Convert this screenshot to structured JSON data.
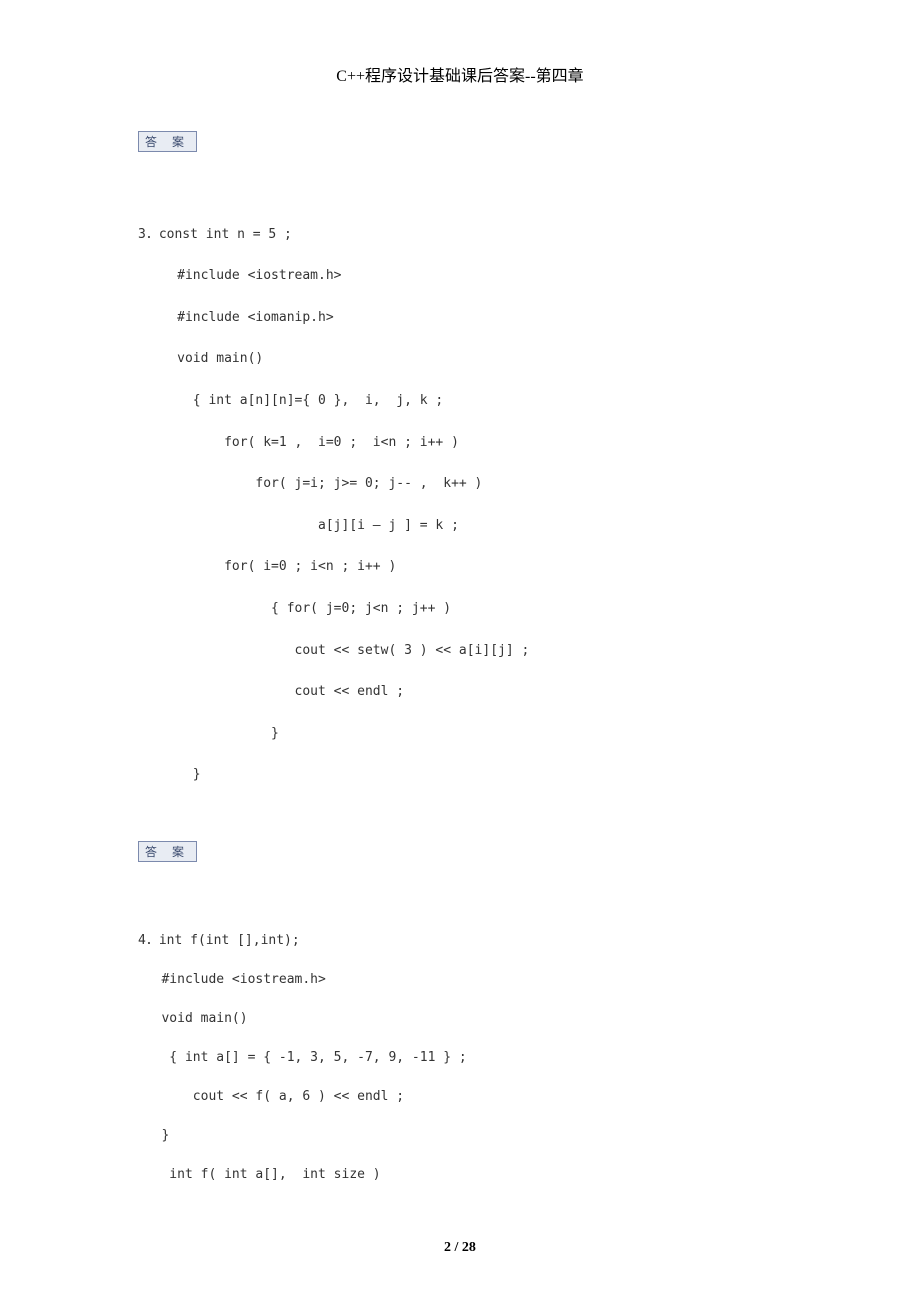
{
  "title": "C++程序设计基础课后答案--第四章",
  "badge1": "答 案",
  "badge2": "答 案",
  "code1_line1": "3．const int n = 5 ;",
  "code1_line2": "     #include <iostream.h>",
  "code1_line3": "     #include <iomanip.h>",
  "code1_line4": "     void main()",
  "code1_line5": "       { int a[n][n]={ 0 },  i,  j, k ;",
  "code1_line6": "           for( k=1 ,  i=0 ;  i<n ; i++ )",
  "code1_line7": "               for( j=i; j>= 0; j-- ,  k++ )",
  "code1_line8": "                       a[j][i – j ] = k ;",
  "code1_line9": "           for( i=0 ; i<n ; i++ )",
  "code1_line10": "                 { for( j=0; j<n ; j++ )",
  "code1_line11": "                    cout << setw( 3 ) << a[i][j] ;",
  "code1_line12": "                    cout << endl ;",
  "code1_line13": "                 }",
  "code1_line14": "       }",
  "code2_line1": "4．int f(int [],int);",
  "code2_line2": "   #include <iostream.h>",
  "code2_line3": "   void main()",
  "code2_line4": "    { int a[] = { -1, 3, 5, -7, 9, -11 } ;",
  "code2_line5": "       cout << f( a, 6 ) << endl ;",
  "code2_line6": "   }",
  "code2_line7": "    int f( int a[],  int size )",
  "footer": "2  / 28"
}
